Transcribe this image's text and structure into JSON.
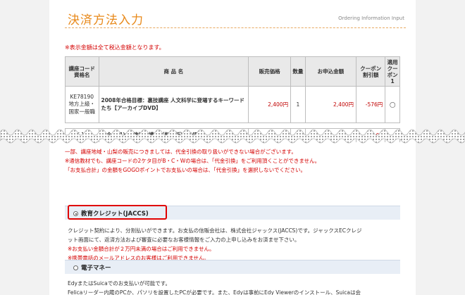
{
  "header": {
    "title": "決済方法入力",
    "subtitle": "Ordering Information Input"
  },
  "notes": {
    "tax": "※表示金額は全て税込金額となります。"
  },
  "table": {
    "headers": {
      "code": "講座コード資格名",
      "name": "商 品 名",
      "price": "販売価格",
      "qty": "数量",
      "total": "お申込金額",
      "coupon": "クーポン割引額",
      "apply": "適用クーポン1"
    },
    "row1": {
      "code1": "KE78190",
      "code2": "地方上級・",
      "code3": "国家一般職",
      "name": "2008年合格目標：裏技講座 人文科学に登場するキーワードたち【アーカイブDVD】",
      "price": "2,400円",
      "qty": "1",
      "total": "2,400円",
      "coupon": "-576円",
      "apply": "◯"
    },
    "row2": {
      "code": "K 10",
      "name": "発令予想と試験対策講座（無料版）DVD",
      "price": "",
      "qty": "",
      "total": "",
      "coupon": "-95"
    }
  },
  "warnings": {
    "w1": "一部、講座地域・山梨の販売につきましては、代金引換の取り扱いができない場合がございます。",
    "w2": "※通信教材でも、講座コードの2ケタ目がB・C・Wの場合は、「代金引換」をご利用頂くことができません。",
    "w3": "「お支払合計」の金額をGOGOポイントでお支払いの場合は、「代金引換」を選択しないでください。"
  },
  "payment_credit": {
    "label": "教育クレジット(JACCS)",
    "desc1": "クレジット契約により、分割払いができます。お支払の信販会社は、株式会社ジャックス(JACCS)です。ジャックスECクレジ",
    "desc2": "ット画面にて、返済方法および審査に必要なお客様情報をご入力の上申し込みをお済ませ下さい。",
    "note1": "※お支払い金額合計が２万円未満の場合はご利用できません。",
    "note2": "※携帯電話のメールアドレスのお客様はご利用できません。"
  },
  "payment_emoney": {
    "label": "電子マネー",
    "desc1": "EdyまたはSuicaでのお支払いが可能です。",
    "desc2": "Felicaリーダー内蔵のPCか、パソリを設置したPCが必要です。また、Edyは事前にEdy Viewerのインストール、Suicaは会"
  },
  "colors": {
    "accent_orange": "#e8891a",
    "warning_red": "#d40000",
    "highlight_red": "#e00000",
    "section_bar": "#e8eef6"
  }
}
